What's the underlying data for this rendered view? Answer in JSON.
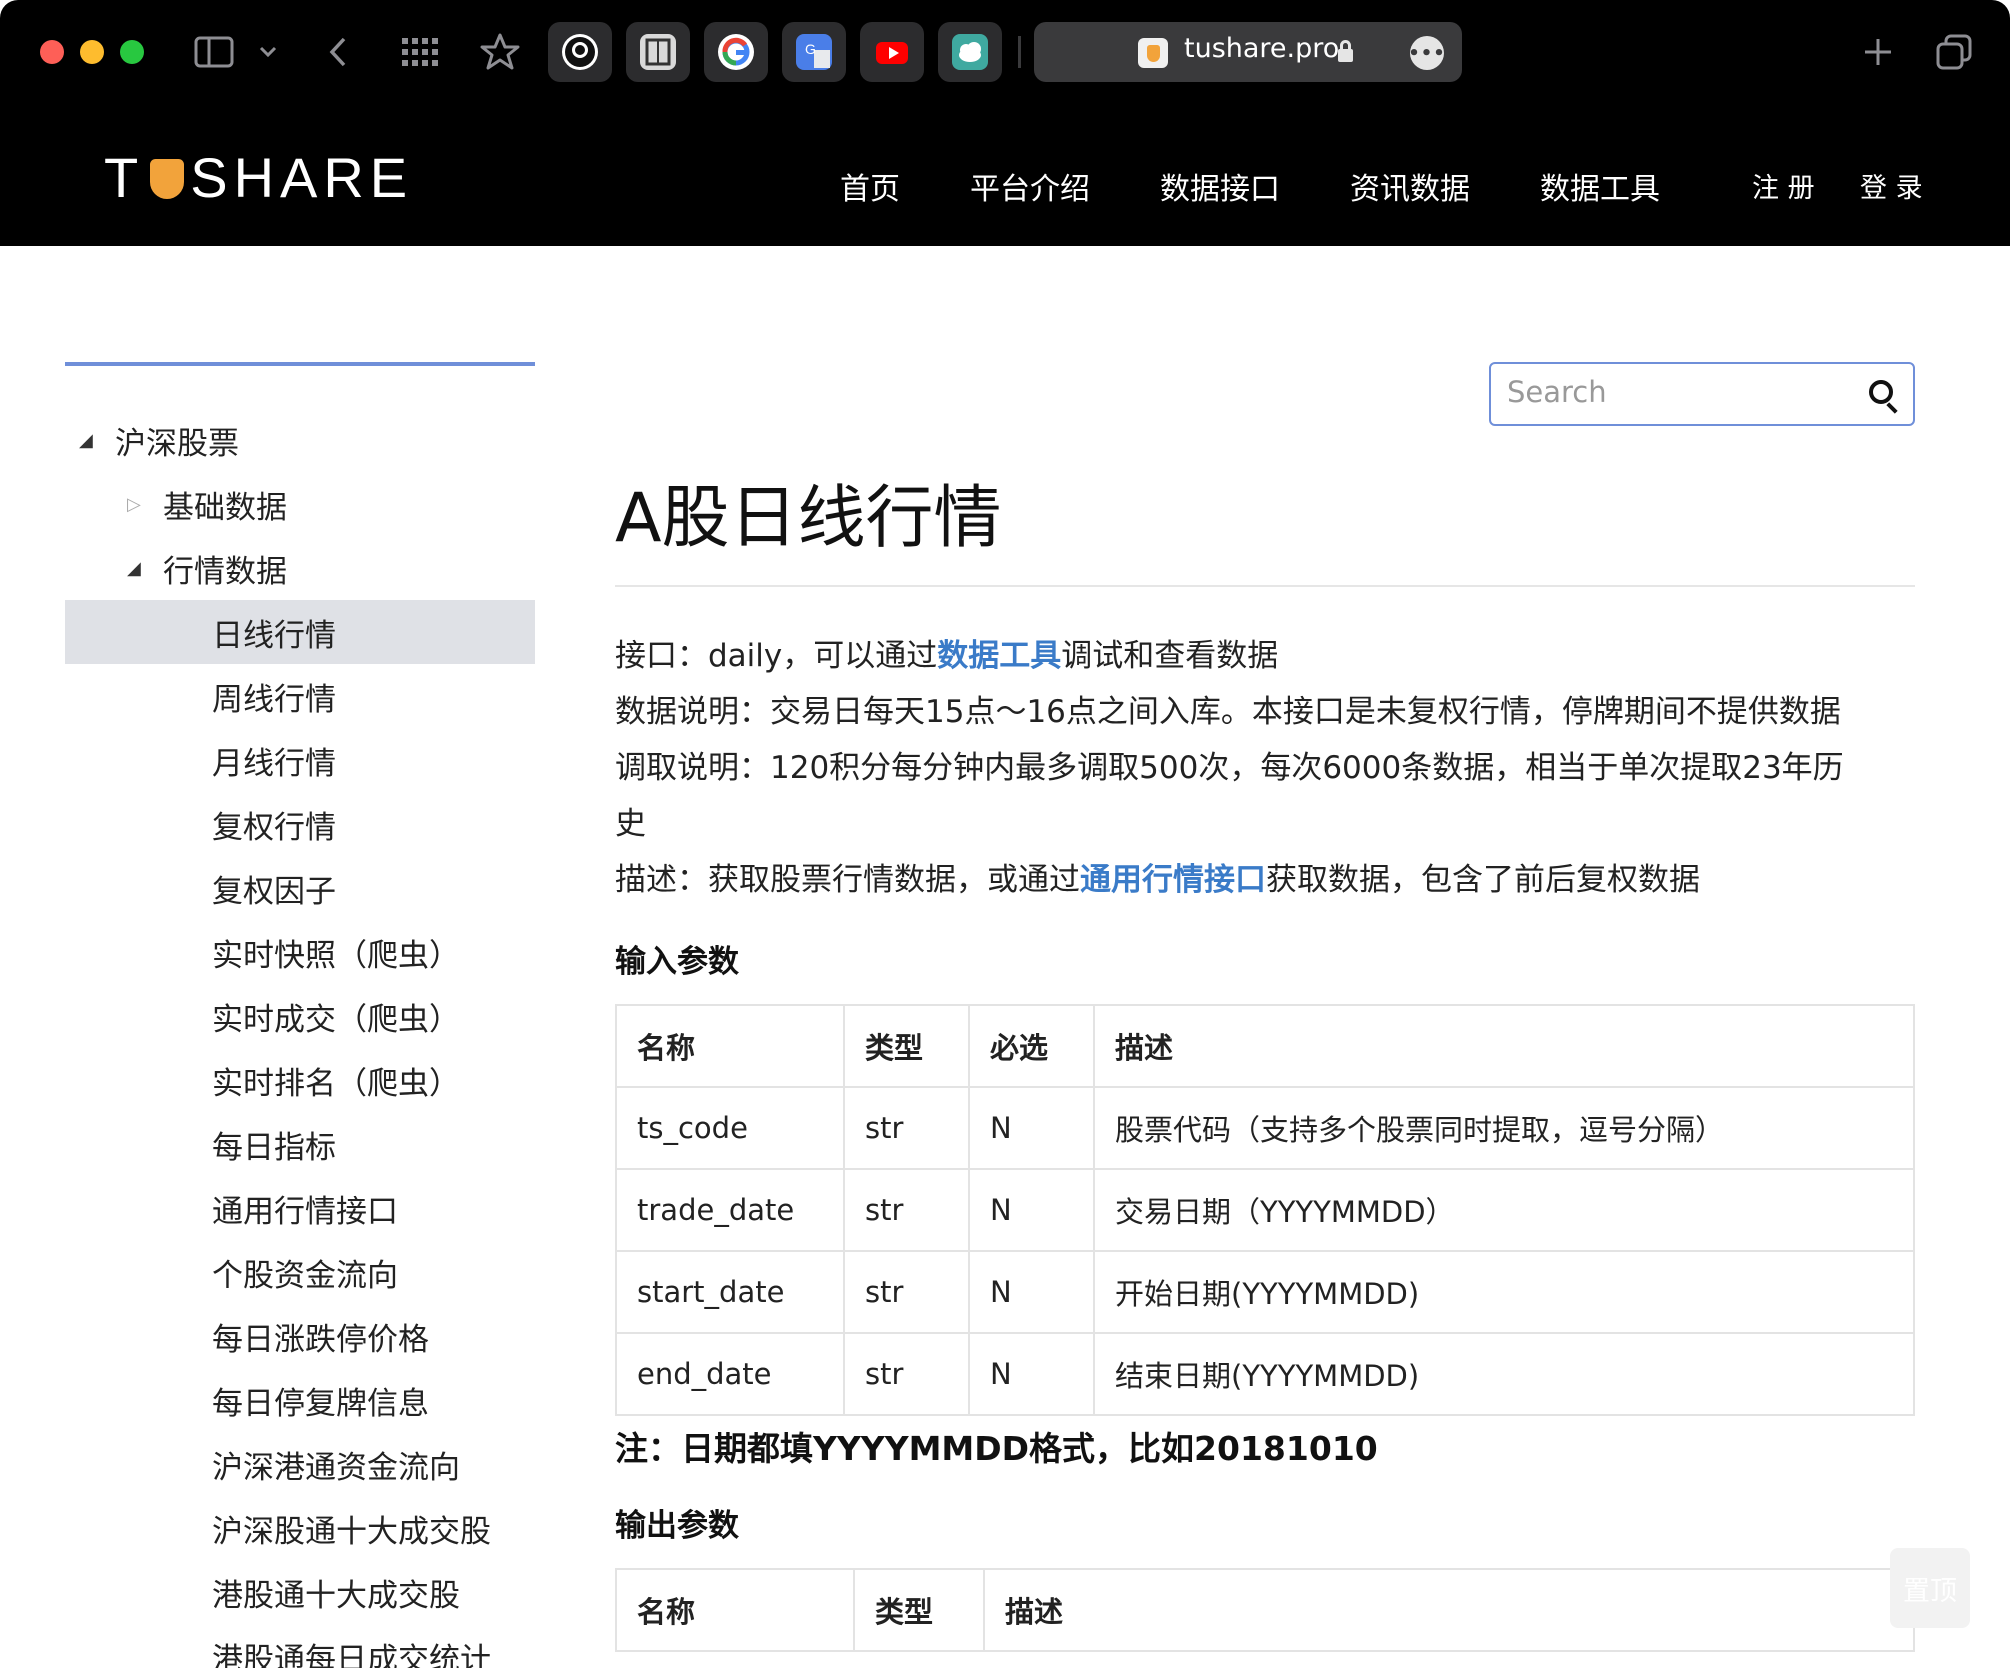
{
  "browser": {
    "url_domain": "tushare.pro",
    "tabs": [
      "github",
      "reader",
      "google",
      "translate",
      "youtube",
      "cloud"
    ]
  },
  "site": {
    "logo_text": [
      "T",
      "SHARE"
    ],
    "nav": [
      "首页",
      "平台介绍",
      "数据接口",
      "资讯数据",
      "数据工具"
    ],
    "register": "注 册",
    "login": "登 录"
  },
  "sidebar": {
    "items": [
      {
        "label": "沪深股票",
        "level": 0,
        "expanded": true
      },
      {
        "label": "基础数据",
        "level": 1,
        "expanded": false
      },
      {
        "label": "行情数据",
        "level": 1,
        "expanded": true
      },
      {
        "label": "日线行情",
        "level": 2,
        "active": true
      },
      {
        "label": "周线行情",
        "level": 2
      },
      {
        "label": "月线行情",
        "level": 2
      },
      {
        "label": "复权行情",
        "level": 2
      },
      {
        "label": "复权因子",
        "level": 2
      },
      {
        "label": "实时快照（爬虫）",
        "level": 2
      },
      {
        "label": "实时成交（爬虫）",
        "level": 2
      },
      {
        "label": "实时排名（爬虫）",
        "level": 2
      },
      {
        "label": "每日指标",
        "level": 2
      },
      {
        "label": "通用行情接口",
        "level": 2
      },
      {
        "label": "个股资金流向",
        "level": 2
      },
      {
        "label": "每日涨跌停价格",
        "level": 2
      },
      {
        "label": "每日停复牌信息",
        "level": 2
      },
      {
        "label": "沪深港通资金流向",
        "level": 2
      },
      {
        "label": "沪深股通十大成交股",
        "level": 2
      },
      {
        "label": "港股通十大成交股",
        "level": 2
      },
      {
        "label": "港股通每日成交统计",
        "level": 2
      }
    ]
  },
  "search": {
    "placeholder": "Search"
  },
  "main": {
    "title": "A股日线行情",
    "line1": {
      "pre": "接口：daily，可以通过",
      "link": "数据工具",
      "post": "调试和查看数据"
    },
    "line2": "数据说明：交易日每天15点～16点之间入库。本接口是未复权行情，停牌期间不提供数据",
    "line3a": "调取说明：120积分每分钟内最多调取500次，每次6000条数据，相当于单次提取23年历",
    "line3b": "史",
    "line4": {
      "pre": "描述：获取股票行情数据，或通过",
      "link": "通用行情接口",
      "post": "获取数据，包含了前后复权数据"
    },
    "input_title": "输入参数",
    "input_headers": [
      "名称",
      "类型",
      "必选",
      "描述"
    ],
    "input_rows": [
      [
        "ts_code",
        "str",
        "N",
        "股票代码（支持多个股票同时提取，逗号分隔）"
      ],
      [
        "trade_date",
        "str",
        "N",
        "交易日期（YYYYMMDD）"
      ],
      [
        "start_date",
        "str",
        "N",
        "开始日期(YYYYMMDD)"
      ],
      [
        "end_date",
        "str",
        "N",
        "结束日期(YYYYMMDD)"
      ]
    ],
    "note": "注：日期都填YYYYMMDD格式，比如20181010",
    "output_title": "输出参数",
    "output_headers": [
      "名称",
      "类型",
      "描述"
    ]
  },
  "back_to_top": "置顶"
}
